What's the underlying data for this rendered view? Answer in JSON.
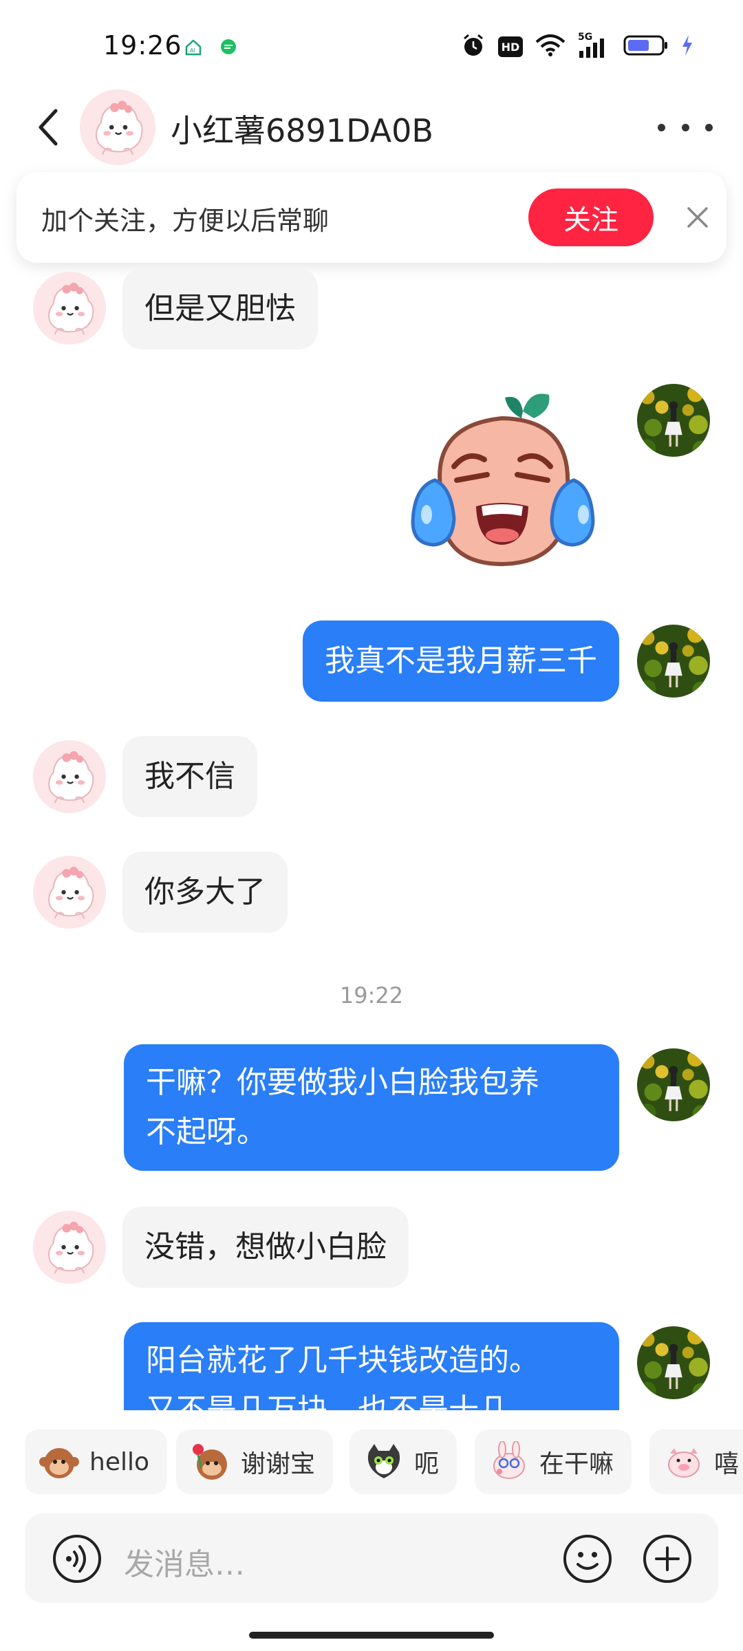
{
  "status_bar": {
    "time": "19:26",
    "left_icons": [
      "ai-home-icon",
      "chat-app-icon"
    ],
    "right_icons": [
      "alarm-icon",
      "hd-icon",
      "wifi-icon",
      "signal-5g-icon",
      "battery-icon",
      "charging-icon"
    ],
    "hd_label": "HD",
    "network_label": "5G"
  },
  "header": {
    "title": "小红薯6891DA0B",
    "back_icon": "chevron-left-icon",
    "more_icon": "more-horizontal-icon"
  },
  "follow_card": {
    "text": "加个关注，方便以后常聊",
    "button_label": "关注",
    "close_icon": "close-icon",
    "accent_color": "#ff2442"
  },
  "messages": [
    {
      "from": "peer",
      "text": "但是又胆怯"
    },
    {
      "from": "me",
      "type": "sticker",
      "sticker": "laughing-tears-sticker-icon"
    },
    {
      "from": "me",
      "text": "我真不是我月薪三千"
    },
    {
      "from": "peer",
      "text": "我不信"
    },
    {
      "from": "peer",
      "text": "你多大了"
    },
    {
      "type": "time",
      "text": "19:22"
    },
    {
      "from": "me",
      "lines": [
        "干嘛？你要做我小白脸我包养",
        "不起呀。"
      ]
    },
    {
      "from": "peer",
      "text": "没错，想做小白脸"
    },
    {
      "from": "me",
      "lines": [
        "阳台就花了几千块钱改造的。",
        "又不是几万块，也不是十几"
      ]
    }
  ],
  "quick_replies": [
    {
      "label": "hello",
      "icon": "monkey-wave-emoji-icon"
    },
    {
      "label": "谢谢宝",
      "icon": "monkey-rose-emoji-icon"
    },
    {
      "label": "呃",
      "icon": "cat-emoji-icon"
    },
    {
      "label": "在干嘛",
      "icon": "bunny-emoji-icon"
    },
    {
      "label": "嘻",
      "icon": "pig-emoji-icon"
    }
  ],
  "input_bar": {
    "placeholder": "发消息…",
    "voice_icon": "voice-icon",
    "emoji_icon": "smile-icon",
    "plus_icon": "plus-icon"
  },
  "colors": {
    "my_bubble": "#2a7ef7",
    "peer_bubble": "#f4f4f4"
  }
}
